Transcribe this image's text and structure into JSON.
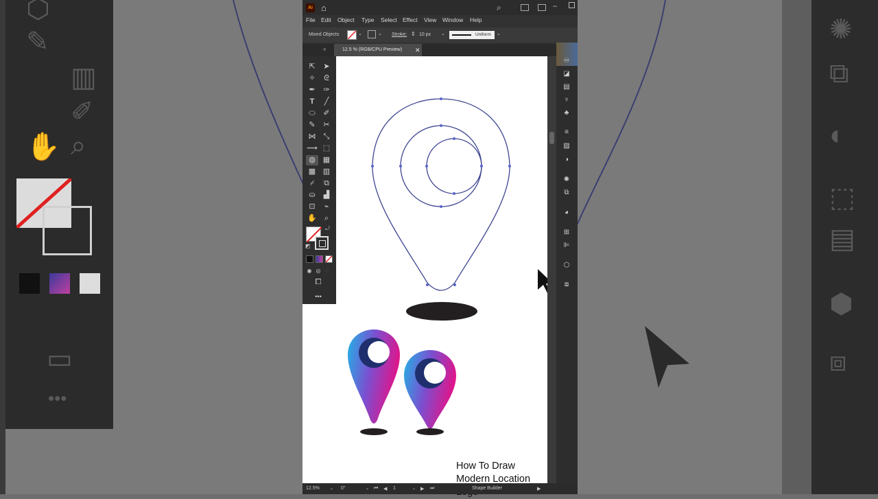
{
  "app": {
    "logo": "Ai",
    "colors": {
      "accent": "#2f7bd6",
      "pin_cyan": "#21b3e6",
      "pin_purple": "#7b4fd0",
      "pin_magenta": "#e0158a",
      "outline_blue": "#3d4590"
    }
  },
  "menu": [
    "File",
    "Edit",
    "Object",
    "Type",
    "Select",
    "Effect",
    "View",
    "Window",
    "Help"
  ],
  "control": {
    "selection": "Mixed Objects",
    "stroke_label": "Stroke:",
    "stroke_value": "10 px",
    "profile": "Uniform"
  },
  "tab": {
    "label": "12.5 % (RGB/CPU Preview)"
  },
  "status": {
    "zoom": "12.5%",
    "rotation": "0°",
    "artboard": "1",
    "tool": "Shape Builder"
  },
  "caption": {
    "line1": "How To Draw",
    "line2": "Modern Location Logo"
  },
  "icons": [
    "home-icon",
    "search-icon",
    "arrange-documents-icon",
    "close-icon",
    "selection-tool-icon",
    "direct-selection-tool-icon",
    "pen-tool-icon",
    "type-tool-icon",
    "shape-builder-tool-icon",
    "hand-tool-icon",
    "zoom-tool-icon"
  ]
}
